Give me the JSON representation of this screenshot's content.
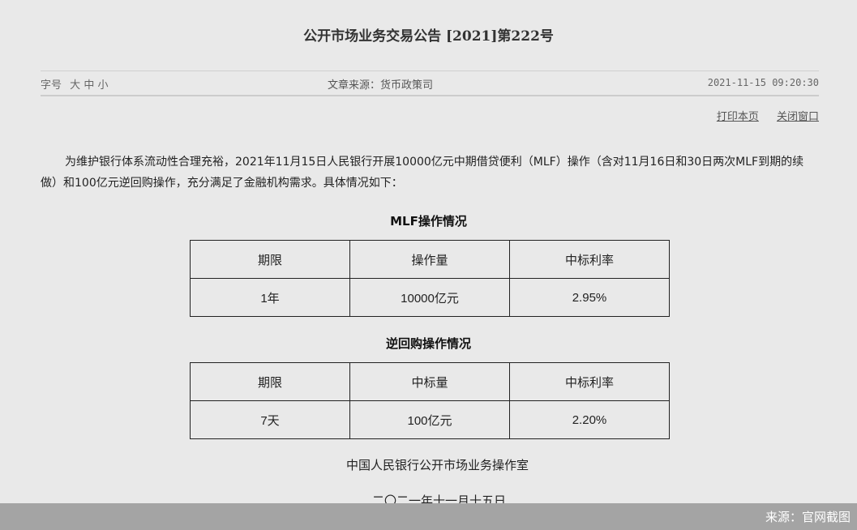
{
  "page": {
    "title": "公开市场业务交易公告 [2021]第222号"
  },
  "meta": {
    "font_size_label": "字号",
    "font_sizes": [
      "大",
      "中",
      "小"
    ],
    "source": "文章来源：货币政策司",
    "datetime": "2021-11-15 09:20:30"
  },
  "actions": {
    "print": "打印本页",
    "close": "关闭窗口"
  },
  "body": {
    "paragraph": "为维护银行体系流动性合理充裕，2021年11月15日人民银行开展10000亿元中期借贷便利（MLF）操作（含对11月16日和30日两次MLF到期的续做）和100亿元逆回购操作，充分满足了金融机构需求。具体情况如下："
  },
  "mlf_table": {
    "title": "MLF操作情况",
    "headers": [
      "期限",
      "操作量",
      "中标利率"
    ],
    "rows": [
      [
        "1年",
        "10000亿元",
        "2.95%"
      ]
    ]
  },
  "repo_table": {
    "title": "逆回购操作情况",
    "headers": [
      "期限",
      "中标量",
      "中标利率"
    ],
    "rows": [
      [
        "7天",
        "100亿元",
        "2.20%"
      ]
    ]
  },
  "signature": {
    "org": "中国人民银行公开市场业务操作室",
    "date": "二〇二一年十一月十五日"
  },
  "overlay": {
    "source_note": "来源：官网截图"
  }
}
